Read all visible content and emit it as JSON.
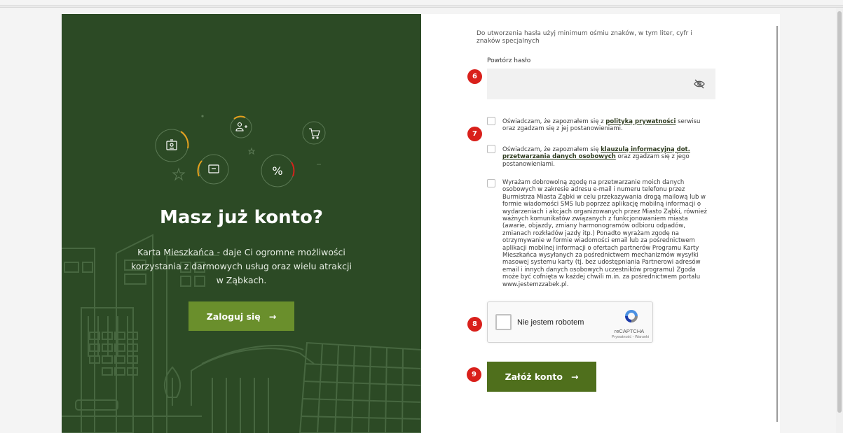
{
  "left_panel": {
    "title": "Masz już konto?",
    "description": "Karta Mieszkańca - daje Ci ogromne możliwości korzystania z darmowych usług oraz wielu atrakcji w Ząbkach.",
    "login_button": {
      "label": "Zaloguj się",
      "arrow": "→"
    },
    "icons": [
      "id-card-icon",
      "ticket-icon",
      "add-user-icon",
      "percent-icon",
      "cart-icon",
      "star-icon",
      "leaf-tree-icon"
    ],
    "percent_symbol": "%"
  },
  "form": {
    "password_hint": "Do utworzenia hasła użyj minimum ośmiu znaków, w tym liter, cyfr i znaków specjalnych",
    "repeat_password_label": "Powtórz hasło",
    "repeat_password_value": "",
    "consent_privacy": {
      "prefix": "Oświadczam, że zapoznałem się z ",
      "link": "polityką prywatności",
      "suffix": " serwisu oraz zgadzam się z jej postanowieniami."
    },
    "consent_clause": {
      "prefix": "Oświadczam, że zapoznałem się ",
      "link": "klauzulą informacyjną dot. przetwarzania danych osobowych",
      "suffix": " oraz zgadzam się z jego postanowieniami."
    },
    "consent_marketing": "Wyrażam dobrowolną zgodę na przetwarzanie moich danych osobowych w zakresie adresu e-mail i numeru telefonu przez Burmistrza Miasta Ząbki w celu przekazywania drogą mailową lub w formie wiadomości SMS lub poprzez aplikację mobilną informacji o wydarzeniach i akcjach organizowanych przez Miasto Ząbki, również ważnych komunikatów związanych z funkcjonowaniem miasta (awarie, objazdy, zmiany harmonogramów odbioru odpadów, zmianach rozkładów jazdy itp.) Ponadto wyrażam zgodę na otrzymywanie w formie wiadomości email lub za pośrednictwem aplikacji mobilnej informacji o ofertach partnerów Programu Karty Mieszkańca wysyłanych za pośrednictwem mechanizmów wysyłki masowej systemu karty (tj. bez udostępniania Partnerowi adresów email i innych danych osobowych uczestników programu) Zgoda może być cofnięta w każdej chwili m.in. za pośrednictwem portalu www.jestemzzabek.pl.",
    "captcha": {
      "label": "Nie jestem robotem",
      "brand": "reCAPTCHA",
      "terms": "Prywatność - Warunki"
    },
    "submit_button": {
      "label": "Załóż konto",
      "arrow": "→"
    }
  },
  "annotations": {
    "b6": "6",
    "b7": "7",
    "b8": "8",
    "b9": "9"
  },
  "colors": {
    "left_bg": "#2c4a25",
    "button_green": "#6a8f2c",
    "submit_green": "#4f6f1c",
    "badge_red": "#d9201b"
  }
}
